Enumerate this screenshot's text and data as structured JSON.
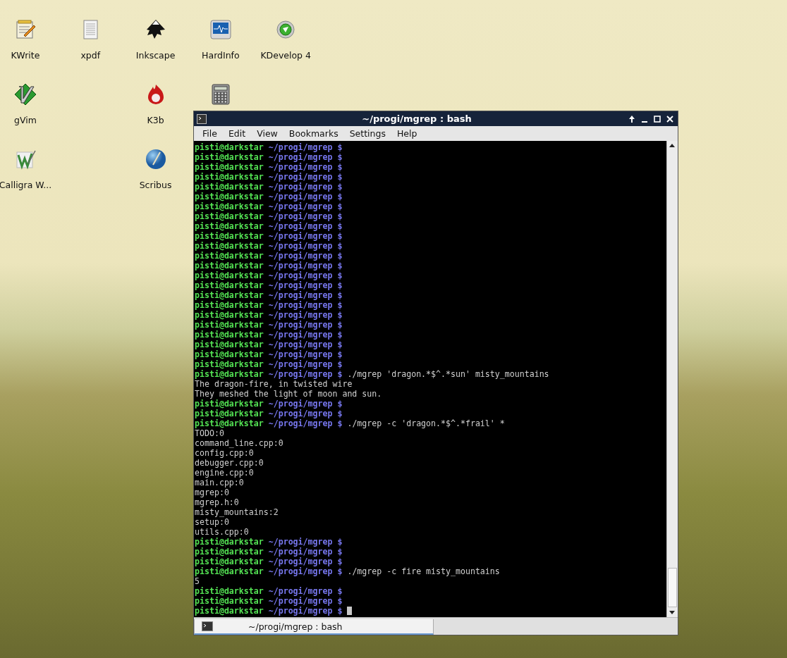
{
  "desktop": {
    "icons": [
      {
        "kind": "editor",
        "label": "KWrite"
      },
      {
        "kind": "document",
        "label": "xpdf"
      },
      {
        "kind": "vector",
        "label": "Inkscape"
      },
      {
        "kind": "monitor",
        "label": "HardInfo"
      },
      {
        "kind": "ide",
        "label": "KDevelop 4"
      },
      {
        "kind": "vim",
        "label": "gVim"
      },
      {
        "kind": "burn",
        "label": "K3b"
      },
      {
        "kind": "calculator"
      },
      {
        "kind": "wordprocessor",
        "label": "Calligra W..."
      },
      {
        "kind": "globe",
        "label": "Scribus"
      }
    ]
  },
  "window": {
    "title": "~/progi/mgrep : bash",
    "menu": [
      "File",
      "Edit",
      "View",
      "Bookmarks",
      "Settings",
      "Help"
    ],
    "terminal": {
      "cursor": true,
      "lines": [
        {
          "kind": "prompt",
          "user": "pisti@darkstar",
          "path": "~/progi/mgrep $"
        },
        {
          "kind": "prompt",
          "user": "pisti@darkstar",
          "path": "~/progi/mgrep $"
        },
        {
          "kind": "prompt",
          "user": "pisti@darkstar",
          "path": "~/progi/mgrep $"
        },
        {
          "kind": "prompt",
          "user": "pisti@darkstar",
          "path": "~/progi/mgrep $"
        },
        {
          "kind": "prompt",
          "user": "pisti@darkstar",
          "path": "~/progi/mgrep $"
        },
        {
          "kind": "prompt",
          "user": "pisti@darkstar",
          "path": "~/progi/mgrep $"
        },
        {
          "kind": "prompt",
          "user": "pisti@darkstar",
          "path": "~/progi/mgrep $"
        },
        {
          "kind": "prompt",
          "user": "pisti@darkstar",
          "path": "~/progi/mgrep $"
        },
        {
          "kind": "prompt",
          "user": "pisti@darkstar",
          "path": "~/progi/mgrep $"
        },
        {
          "kind": "prompt",
          "user": "pisti@darkstar",
          "path": "~/progi/mgrep $"
        },
        {
          "kind": "prompt",
          "user": "pisti@darkstar",
          "path": "~/progi/mgrep $"
        },
        {
          "kind": "prompt",
          "user": "pisti@darkstar",
          "path": "~/progi/mgrep $"
        },
        {
          "kind": "prompt",
          "user": "pisti@darkstar",
          "path": "~/progi/mgrep $"
        },
        {
          "kind": "prompt",
          "user": "pisti@darkstar",
          "path": "~/progi/mgrep $"
        },
        {
          "kind": "prompt",
          "user": "pisti@darkstar",
          "path": "~/progi/mgrep $"
        },
        {
          "kind": "prompt",
          "user": "pisti@darkstar",
          "path": "~/progi/mgrep $"
        },
        {
          "kind": "prompt",
          "user": "pisti@darkstar",
          "path": "~/progi/mgrep $"
        },
        {
          "kind": "prompt",
          "user": "pisti@darkstar",
          "path": "~/progi/mgrep $"
        },
        {
          "kind": "prompt",
          "user": "pisti@darkstar",
          "path": "~/progi/mgrep $"
        },
        {
          "kind": "prompt",
          "user": "pisti@darkstar",
          "path": "~/progi/mgrep $"
        },
        {
          "kind": "prompt",
          "user": "pisti@darkstar",
          "path": "~/progi/mgrep $"
        },
        {
          "kind": "prompt",
          "user": "pisti@darkstar",
          "path": "~/progi/mgrep $"
        },
        {
          "kind": "prompt",
          "user": "pisti@darkstar",
          "path": "~/progi/mgrep $"
        },
        {
          "kind": "prompt",
          "user": "pisti@darkstar",
          "path": "~/progi/mgrep $",
          "command": "./mgrep 'dragon.*$^.*sun' misty_mountains"
        },
        {
          "kind": "output",
          "text": "The dragon-fire, in twisted wire"
        },
        {
          "kind": "output",
          "text": "They meshed the light of moon and sun."
        },
        {
          "kind": "prompt",
          "user": "pisti@darkstar",
          "path": "~/progi/mgrep $"
        },
        {
          "kind": "prompt",
          "user": "pisti@darkstar",
          "path": "~/progi/mgrep $"
        },
        {
          "kind": "prompt",
          "user": "pisti@darkstar",
          "path": "~/progi/mgrep $",
          "command": "./mgrep -c 'dragon.*$^.*frail' *"
        },
        {
          "kind": "output",
          "text": "TODO:0"
        },
        {
          "kind": "output",
          "text": "command_line.cpp:0"
        },
        {
          "kind": "output",
          "text": "config.cpp:0"
        },
        {
          "kind": "output",
          "text": "debugger.cpp:0"
        },
        {
          "kind": "output",
          "text": "engine.cpp:0"
        },
        {
          "kind": "output",
          "text": "main.cpp:0"
        },
        {
          "kind": "output",
          "text": "mgrep:0"
        },
        {
          "kind": "output",
          "text": "mgrep.h:0"
        },
        {
          "kind": "output",
          "text": "misty_mountains:2"
        },
        {
          "kind": "output",
          "text": "setup:0"
        },
        {
          "kind": "output",
          "text": "utils.cpp:0"
        },
        {
          "kind": "prompt",
          "user": "pisti@darkstar",
          "path": "~/progi/mgrep $"
        },
        {
          "kind": "prompt",
          "user": "pisti@darkstar",
          "path": "~/progi/mgrep $"
        },
        {
          "kind": "prompt",
          "user": "pisti@darkstar",
          "path": "~/progi/mgrep $"
        },
        {
          "kind": "prompt",
          "user": "pisti@darkstar",
          "path": "~/progi/mgrep $",
          "command": "./mgrep -c fire misty_mountains"
        },
        {
          "kind": "output",
          "text": "5"
        },
        {
          "kind": "prompt",
          "user": "pisti@darkstar",
          "path": "~/progi/mgrep $"
        },
        {
          "kind": "prompt",
          "user": "pisti@darkstar",
          "path": "~/progi/mgrep $"
        },
        {
          "kind": "prompt",
          "user": "pisti@darkstar",
          "path": "~/progi/mgrep $"
        }
      ]
    },
    "tabs": [
      {
        "label": "~/progi/mgrep : bash",
        "selected": true
      }
    ]
  }
}
